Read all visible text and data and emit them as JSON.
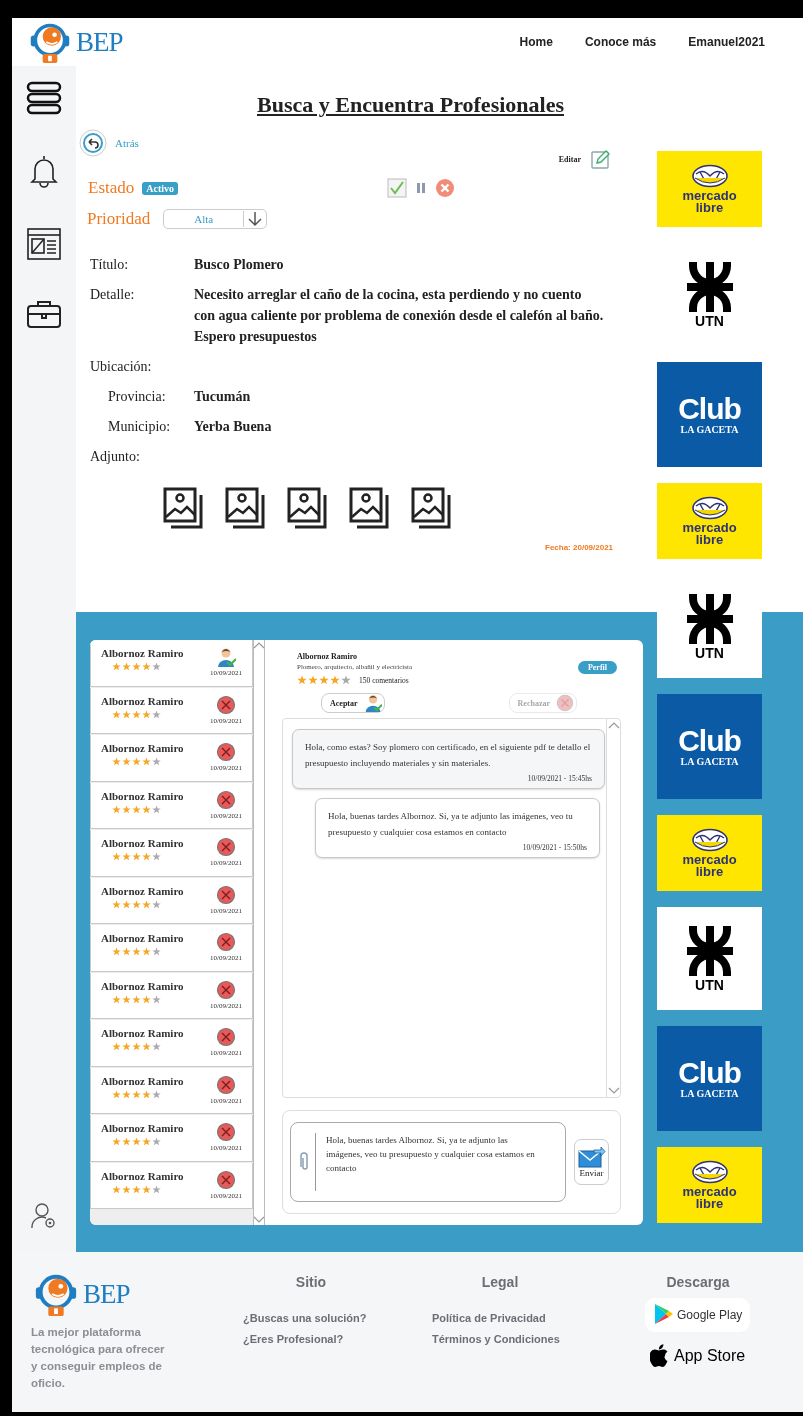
{
  "header": {
    "logo_text": "BEP",
    "nav": [
      {
        "label": "Home"
      },
      {
        "label": "Conoce más"
      },
      {
        "label": "Emanuel2021"
      }
    ]
  },
  "page_title": "Busca y Encuentra Profesionales",
  "back": {
    "label": "Atrás"
  },
  "edit": {
    "label": "Editar"
  },
  "status": {
    "label": "Estado",
    "badge": "Activo"
  },
  "priority": {
    "label": "Prioridad",
    "value": "Alta"
  },
  "details": [
    {
      "label": "Título:",
      "value": "Busco Plomero"
    },
    {
      "label": "Detalle:",
      "value": "Necesito arreglar el caño de la cocina, esta perdiendo y  no cuento con agua caliente por problema de conexión desde el calefón al baño. Espero presupuestos"
    },
    {
      "label": "Ubicación:",
      "children": [
        {
          "label": "Provincia:",
          "value": "Tucumán"
        },
        {
          "label": "Municipio:",
          "value": "Yerba Buena"
        }
      ]
    },
    {
      "label": "Adjunto:"
    }
  ],
  "attachments": [
    {
      "kind": "image"
    },
    {
      "kind": "image"
    },
    {
      "kind": "image"
    },
    {
      "kind": "image"
    },
    {
      "kind": "image"
    }
  ],
  "date": "Fecha: 20/09/2021",
  "ads": [
    {
      "kind": "mercadolibre",
      "text": "mercado libre"
    },
    {
      "kind": "utn",
      "text": "UTN"
    },
    {
      "kind": "club",
      "title": "Club",
      "subtitle": "LA GACETA"
    },
    {
      "kind": "mercadolibre",
      "text": "mercado libre"
    },
    {
      "kind": "utn",
      "text": "UTN"
    },
    {
      "kind": "club",
      "title": "Club",
      "subtitle": "LA GACETA"
    },
    {
      "kind": "mercadolibre",
      "text": "mercado libre"
    },
    {
      "kind": "utn",
      "text": "UTN"
    },
    {
      "kind": "club",
      "title": "Club",
      "subtitle": "LA GACETA"
    },
    {
      "kind": "mercadolibre",
      "text": "mercado libre"
    }
  ],
  "applicants": [
    {
      "name": "Albornoz Ramiro",
      "stars": 4,
      "date": "10/09/2021",
      "accepted": true
    },
    {
      "name": "Albornoz Ramiro",
      "stars": 4,
      "date": "10/09/2021",
      "accepted": false
    },
    {
      "name": "Albornoz Ramiro",
      "stars": 4,
      "date": "10/09/2021",
      "accepted": false
    },
    {
      "name": "Albornoz Ramiro",
      "stars": 4,
      "date": "10/09/2021",
      "accepted": false
    },
    {
      "name": "Albornoz Ramiro",
      "stars": 4,
      "date": "10/09/2021",
      "accepted": false
    },
    {
      "name": "Albornoz Ramiro",
      "stars": 4,
      "date": "10/09/2021",
      "accepted": false
    },
    {
      "name": "Albornoz Ramiro",
      "stars": 4,
      "date": "10/09/2021",
      "accepted": false
    },
    {
      "name": "Albornoz Ramiro",
      "stars": 4,
      "date": "10/09/2021",
      "accepted": false
    },
    {
      "name": "Albornoz Ramiro",
      "stars": 4,
      "date": "10/09/2021",
      "accepted": false
    },
    {
      "name": "Albornoz Ramiro",
      "stars": 4,
      "date": "10/09/2021",
      "accepted": false
    },
    {
      "name": "Albornoz Ramiro",
      "stars": 4,
      "date": "10/09/2021",
      "accepted": false
    },
    {
      "name": "Albornoz Ramiro",
      "stars": 4,
      "date": "10/09/2021",
      "accepted": false
    }
  ],
  "conversation": {
    "name": "Albornoz Ramiro",
    "profession": "Plomero, arquitecto, albañil y electricista",
    "stars": 4,
    "reviews": "150 comentarios",
    "profile_button": "Perfil",
    "accept_button": {
      "label": "Aceptar",
      "disabled": false
    },
    "reject_button": {
      "label": "Rechazar",
      "disabled": true
    },
    "messages": [
      {
        "kind": "received",
        "text": "Hola, como estas? Soy plomero con certificado, en el siguiente pdf te detallo el presupuesto incluyendo materiales y sin materiales.",
        "time": "10/09/2021 - 15:45hs"
      },
      {
        "kind": "sent",
        "text": "Hola, buenas tardes Albornoz. Si, ya te adjunto las imágenes, veo tu presupuesto y cualquier cosa estamos en contacto",
        "time": "10/09/2021 - 15:50hs"
      }
    ],
    "compose": {
      "value": "Hola, buenas tardes Albornoz. Si, ya te adjunto las imágenes, veo tu presupuesto y cualquier cosa estamos en contacto",
      "send_label": "Enviar"
    }
  },
  "footer": {
    "logo_text": "BEP",
    "tagline": "La mejor plataforma tecnológica para ofrecer y conseguir empleos de oficio.",
    "columns": [
      {
        "title": "Sitio",
        "links": [
          "¿Buscas una solución?",
          "¿Eres Profesional?"
        ]
      },
      {
        "title": "Legal",
        "links": [
          "Política de Privacidad",
          "Términos y Condiciones"
        ]
      },
      {
        "title": "Descarga",
        "badges": [
          {
            "kind": "google-play",
            "label": "Google Play"
          },
          {
            "kind": "app-store",
            "label": "App Store"
          }
        ]
      }
    ]
  }
}
